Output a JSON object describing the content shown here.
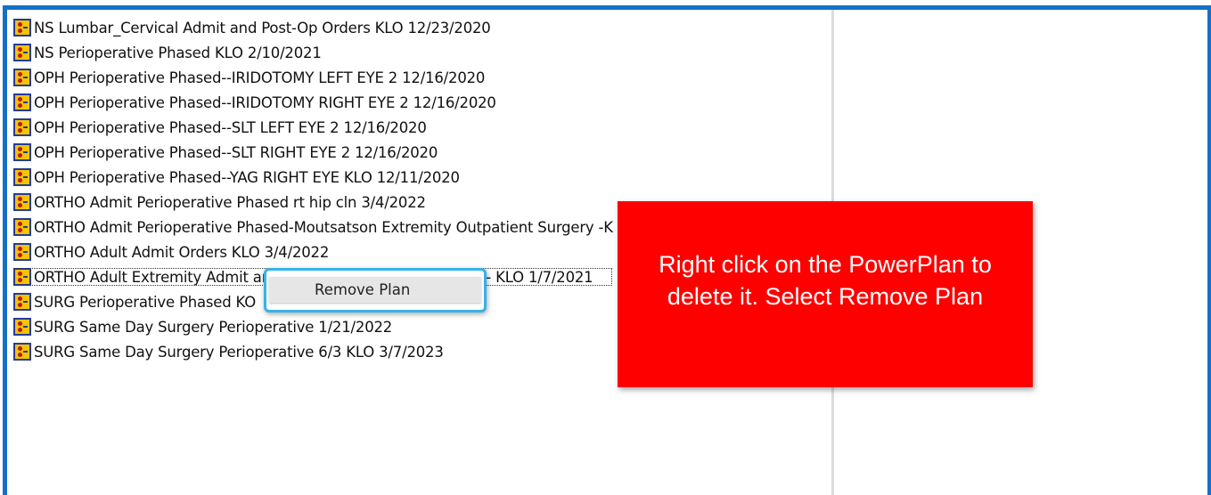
{
  "plans": [
    {
      "label": "NS Lumbar_Cervical Admit and Post-Op Orders KLO  12/23/2020"
    },
    {
      "label": "NS Perioperative Phased KLO  2/10/2021"
    },
    {
      "label": "OPH Perioperative Phased--IRIDOTOMY LEFT EYE 2  12/16/2020"
    },
    {
      "label": "OPH Perioperative Phased--IRIDOTOMY RIGHT EYE 2  12/16/2020"
    },
    {
      "label": "OPH Perioperative Phased--SLT LEFT EYE 2  12/16/2020"
    },
    {
      "label": "OPH Perioperative Phased--SLT RIGHT EYE 2  12/16/2020"
    },
    {
      "label": "OPH Perioperative Phased--YAG RIGHT EYE KLO  12/11/2020"
    },
    {
      "label": "ORTHO Admit Perioperative Phased rt hip cln  3/4/2022"
    },
    {
      "label": "ORTHO Admit Perioperative Phased-Moutsatson Extremity Outpatient Surgery -K"
    },
    {
      "label": "ORTHO Adult Admit Orders KLO  3/4/2022"
    },
    {
      "label": "ORTHO Adult Extremity Admit and Post-Op Orders Moutsatson - KLO  1/7/2021",
      "selected": true
    },
    {
      "label": "SURG Perioperative Phased KO"
    },
    {
      "label": "SURG Same Day Surgery Perioperative  1/21/2022"
    },
    {
      "label": "SURG Same Day Surgery Perioperative 6/3 KLO  3/7/2023"
    }
  ],
  "context_menu": {
    "remove_plan": "Remove Plan"
  },
  "callout": {
    "line1": "Right click on the PowerPlan to",
    "line2": "delete it.  Select Remove Plan"
  },
  "colors": {
    "frame": "#1570c7",
    "callout": "#ff0000",
    "menu_border": "#35b3e8",
    "icon_fill": "#f4c400",
    "icon_border": "#243c9a"
  },
  "icon": "powerplan-icon"
}
